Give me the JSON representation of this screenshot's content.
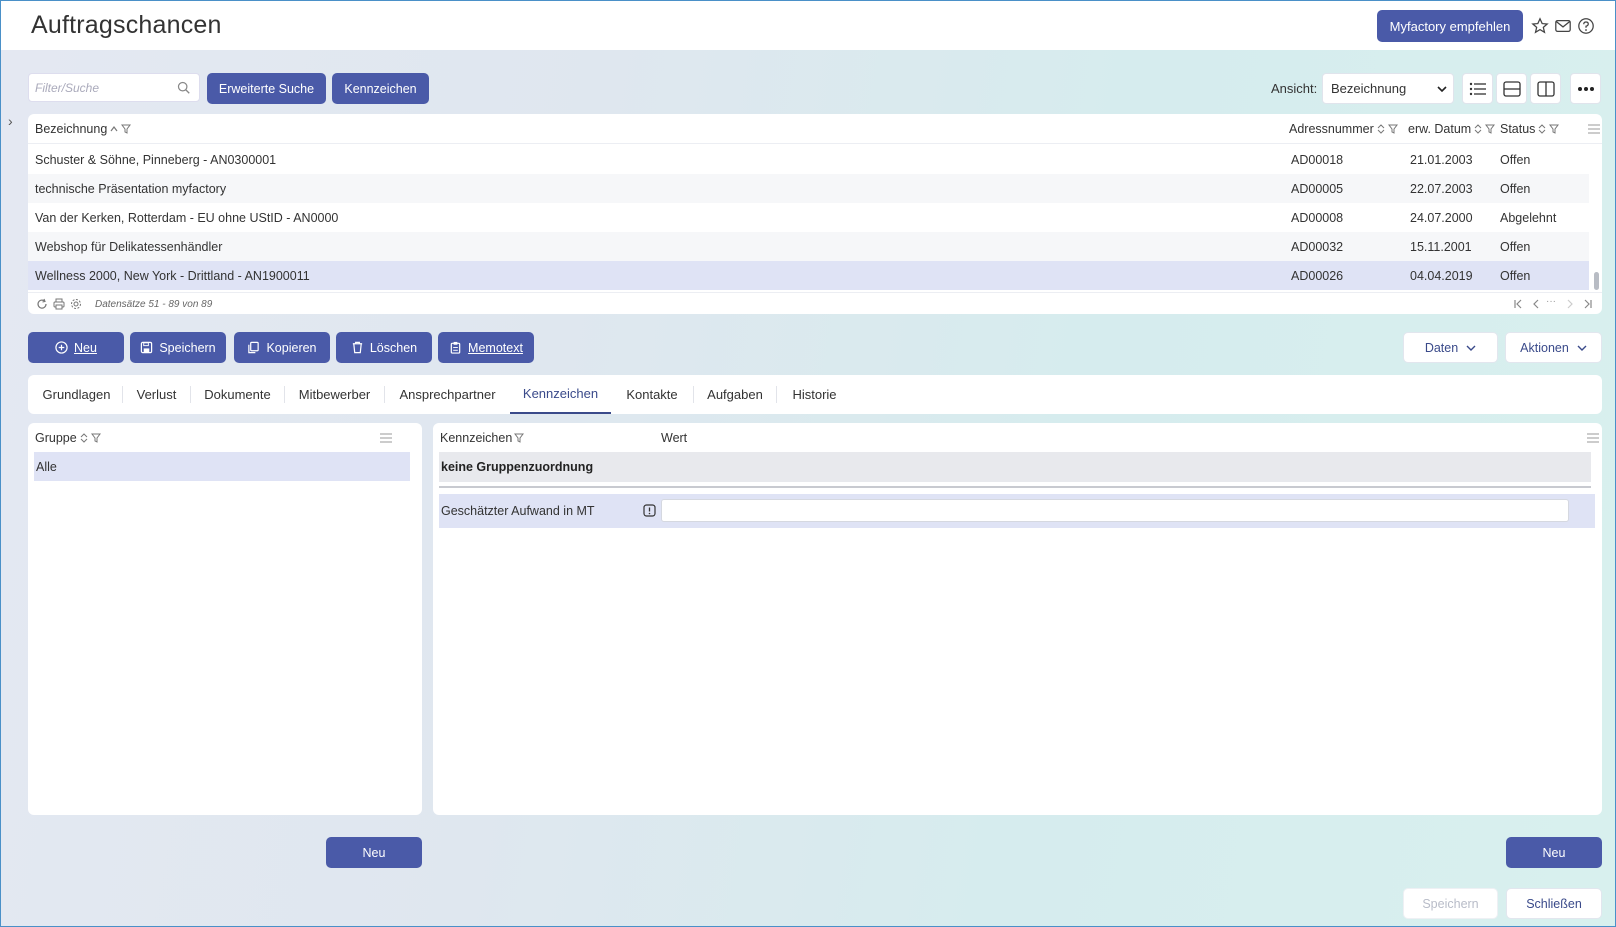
{
  "header": {
    "title": "Auftragschancen",
    "recommend_label": "Myfactory empfehlen"
  },
  "toolbar": {
    "search_placeholder": "Filter/Suche",
    "advanced_search": "Erweiterte Suche",
    "kennzeichen": "Kennzeichen",
    "view_label": "Ansicht:",
    "view_value": "Bezeichnung"
  },
  "grid": {
    "columns": [
      "Bezeichnung",
      "Adressnummer",
      "erw. Datum",
      "Status"
    ],
    "rows": [
      {
        "bez": "Schuster & Söhne, Pinneberg - AN0300001",
        "adr": "AD00018",
        "datum": "21.01.2003",
        "status": "Offen"
      },
      {
        "bez": "technische Präsentation myfactory",
        "adr": "AD00005",
        "datum": "22.07.2003",
        "status": "Offen"
      },
      {
        "bez": "Van der Kerken, Rotterdam - EU ohne UStID - AN0000",
        "adr": "AD00008",
        "datum": "24.07.2000",
        "status": "Abgelehnt"
      },
      {
        "bez": "Webshop für Delikatessenhändler",
        "adr": "AD00032",
        "datum": "15.11.2001",
        "status": "Offen"
      },
      {
        "bez": "Wellness 2000, New York - Drittland - AN1900011",
        "adr": "AD00026",
        "datum": "04.04.2019",
        "status": "Offen"
      }
    ],
    "footer_info": "Datensätze 51 - 89 von 89",
    "pager_dots": "···"
  },
  "actions": {
    "neu": "Neu",
    "speichern": "Speichern",
    "kopieren": "Kopieren",
    "loeschen": "Löschen",
    "memotext": "Memotext",
    "daten": "Daten",
    "aktionen": "Aktionen"
  },
  "tabs": [
    "Grundlagen",
    "Verlust",
    "Dokumente",
    "Mitbewerber",
    "Ansprechpartner",
    "Kennzeichen",
    "Kontakte",
    "Aufgaben",
    "Historie"
  ],
  "active_tab": "Kennzeichen",
  "left_panel": {
    "header": "Gruppe",
    "rows": [
      "Alle"
    ],
    "new_button": "Neu"
  },
  "right_panel": {
    "col_kennzeichen": "Kennzeichen",
    "col_wert": "Wert",
    "group_label": "keine Gruppenzuordnung",
    "field_label": "Geschätzter Aufwand in MT",
    "field_value": "",
    "new_button": "Neu"
  },
  "footer": {
    "save": "Speichern",
    "close": "Schließen"
  },
  "colors": {
    "primary": "#4a5aa8",
    "selection": "#dfe3f5",
    "accent_text": "#3a4a8a"
  }
}
